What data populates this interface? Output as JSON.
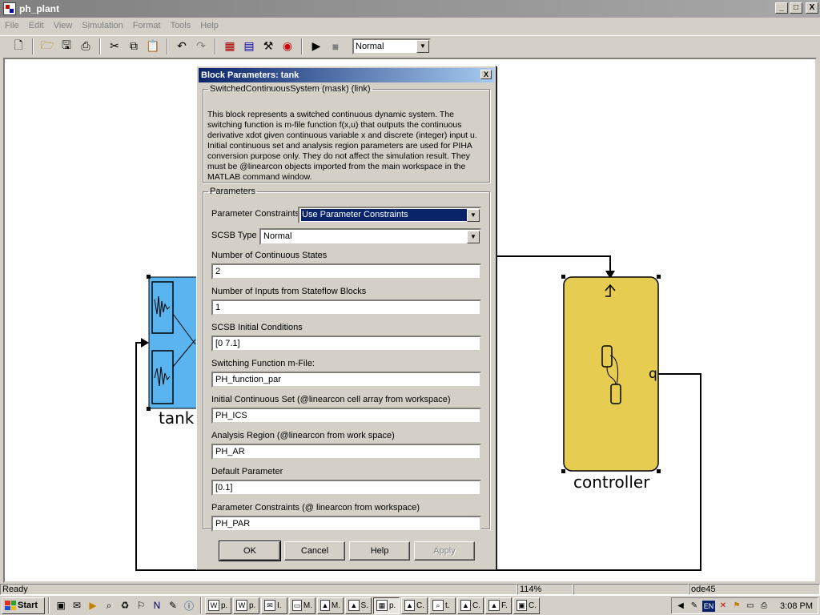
{
  "window": {
    "title": "ph_plant",
    "buttons": [
      "_",
      "□",
      "X"
    ]
  },
  "menu": [
    "File",
    "Edit",
    "View",
    "Simulation",
    "Format",
    "Tools",
    "Help"
  ],
  "toolbar": {
    "icons": [
      "new-file-icon",
      "open-folder-icon",
      "save-icon",
      "print-icon",
      "cut-icon",
      "copy-icon",
      "paste-icon",
      "undo-icon",
      "redo-icon",
      "library-browser-icon",
      "model-browser-icon",
      "debugger-icon",
      "profiler-icon",
      "start-simulation-icon",
      "stop-simulation-icon"
    ],
    "sim_mode": "Normal"
  },
  "diagram": {
    "blocks": {
      "tank": {
        "label": "tank",
        "color": "#5ab4f0"
      },
      "controller": {
        "label": "controller",
        "port_label": "q",
        "color": "#e6cc50"
      }
    }
  },
  "dialog": {
    "title": "Block Parameters: tank",
    "close": "X",
    "mask_legend": "SwitchedContinuousSystem (mask) (link)",
    "mask_description": "This block represents a switched continuous dynamic system. The switching function is m-file function f(x,u) that outputs the continuous derivative xdot given continuous variable x and discrete (integer) input u. Initial continuous set and analysis region parameters are used for PIHA conversion purpose only. They do not affect the simulation result. They must be @linearcon objects imported from the main workspace in the MATLAB command window.",
    "params_legend": "Parameters",
    "param_constraints_label": "Parameter Constraints",
    "param_constraints_value": "Use Parameter Constraints",
    "scsb_type_label": "SCSB Type",
    "scsb_type_value": "Normal",
    "fields": [
      {
        "label": "Number of Continuous States",
        "value": "2"
      },
      {
        "label": "Number of Inputs from Stateflow Blocks",
        "value": "1"
      },
      {
        "label": "SCSB Initial Conditions",
        "value": "[0 7.1]"
      },
      {
        "label": "Switching Function m-File:",
        "value": "PH_function_par"
      },
      {
        "label": "Initial Continuous Set (@linearcon cell array from workspace)",
        "value": "PH_ICS"
      },
      {
        "label": "Analysis Region (@linearcon from work space)",
        "value": "PH_AR"
      },
      {
        "label": "Default Parameter",
        "value": "[0.1]"
      },
      {
        "label": "Parameter Constraints (@ linearcon from workspace)",
        "value": "PH_PAR"
      }
    ],
    "buttons": {
      "ok": "OK",
      "cancel": "Cancel",
      "help": "Help",
      "apply": "Apply"
    }
  },
  "status": {
    "state": "Ready",
    "zoom": "114%",
    "solver": "ode45"
  },
  "taskbar": {
    "start": "Start",
    "tasks": [
      {
        "icon": "W",
        "label": "p."
      },
      {
        "icon": "W",
        "label": "p."
      },
      {
        "icon": "✉",
        "label": "I."
      },
      {
        "icon": "▭",
        "label": "M."
      },
      {
        "icon": "▲",
        "label": "M."
      },
      {
        "icon": "▲",
        "label": "S."
      },
      {
        "icon": "▦",
        "label": "p.",
        "active": true
      },
      {
        "icon": "▲",
        "label": "C."
      },
      {
        "icon": "⌕",
        "label": "t."
      },
      {
        "icon": "▲",
        "label": "C."
      },
      {
        "icon": "▲",
        "label": "F."
      },
      {
        "icon": "▣",
        "label": "C."
      }
    ],
    "tray_lang": "EN",
    "clock": "3:08 PM"
  }
}
